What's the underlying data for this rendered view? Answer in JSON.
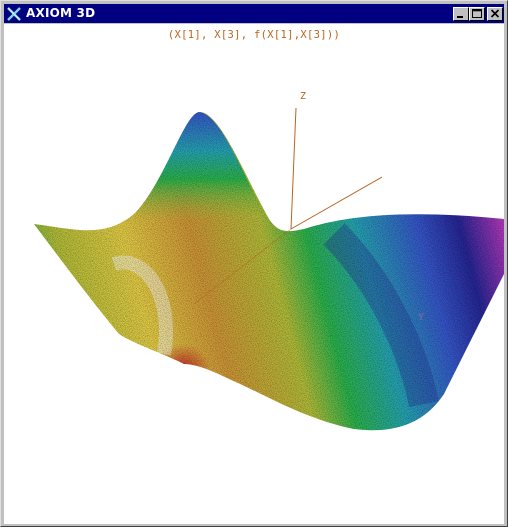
{
  "window": {
    "title": "AXIOM 3D",
    "buttons": [
      "minimize",
      "maximize",
      "close"
    ]
  },
  "plot": {
    "caption": "(X[1], X[3], f(X[1],X[3]))",
    "axis_z_label": "Z",
    "axis_y_label": "Y",
    "colors": {
      "axes": "#b8651f",
      "palette": [
        "#c8232b",
        "#d49a3a",
        "#e9d24a",
        "#b8c23c",
        "#2fb84f",
        "#2aa8b8",
        "#3a5ad0",
        "#2a2a9a",
        "#8a30b8",
        "#d040c8"
      ]
    }
  }
}
